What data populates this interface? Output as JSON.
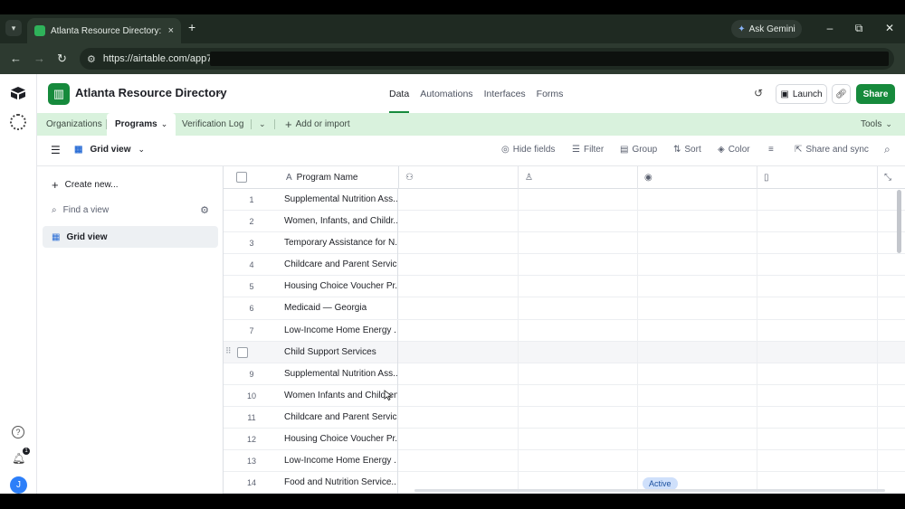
{
  "browser": {
    "tab_title": "Atlanta Resource Directory: Pro",
    "tab_close": "×",
    "new_tab": "+",
    "ask_gemini": "Ask Gemini",
    "url": "https://airtable.com/app7",
    "window_controls": {
      "minimize": "–",
      "restore": "⧉",
      "close": "✕"
    }
  },
  "header": {
    "base_name": "Atlanta Resource Directory",
    "nav": [
      {
        "label": "Data",
        "active": true
      },
      {
        "label": "Automations",
        "active": false
      },
      {
        "label": "Interfaces",
        "active": false
      },
      {
        "label": "Forms",
        "active": false
      }
    ],
    "launch_label": "Launch",
    "share_label": "Share",
    "accent_color": "#168a3c"
  },
  "tables_bar": {
    "tabs": [
      {
        "label": "Organizations",
        "active": false
      },
      {
        "label": "Programs",
        "active": true
      },
      {
        "label": "Verification Log",
        "active": false
      }
    ],
    "add_label": "Add or import",
    "tools_label": "Tools"
  },
  "view_bar": {
    "view_name": "Grid view",
    "hide_fields": "Hide fields",
    "filter": "Filter",
    "group": "Group",
    "sort": "Sort",
    "color": "Color",
    "share_sync": "Share and sync"
  },
  "sidebar": {
    "create_new": "Create new...",
    "find_placeholder": "Find a view",
    "views": [
      "Grid view"
    ]
  },
  "grid": {
    "primary_field": "Program Name",
    "field_icons": [
      "people-icon",
      "user-icon",
      "status-icon",
      "document-icon"
    ],
    "rows": [
      {
        "num": "1",
        "name": "Supplemental Nutrition Ass..."
      },
      {
        "num": "2",
        "name": "Women, Infants, and Childr..."
      },
      {
        "num": "3",
        "name": "Temporary Assistance for N..."
      },
      {
        "num": "4",
        "name": "Childcare and Parent Servic..."
      },
      {
        "num": "5",
        "name": "Housing Choice Voucher Pr..."
      },
      {
        "num": "6",
        "name": "Medicaid — Georgia"
      },
      {
        "num": "7",
        "name": "Low-Income Home Energy ..."
      },
      {
        "num": "",
        "name": "Child Support Services"
      },
      {
        "num": "9",
        "name": "Supplemental Nutrition Ass..."
      },
      {
        "num": "10",
        "name": "Women Infants and Children"
      },
      {
        "num": "11",
        "name": "Childcare and Parent Servic..."
      },
      {
        "num": "12",
        "name": "Housing Choice Voucher Pr..."
      },
      {
        "num": "13",
        "name": "Low-Income Home Energy ..."
      },
      {
        "num": "14",
        "name": "Food and Nutrition Service..."
      }
    ],
    "status_pill": "Active"
  },
  "user": {
    "avatar_initial": "J",
    "notification_count": "1"
  }
}
